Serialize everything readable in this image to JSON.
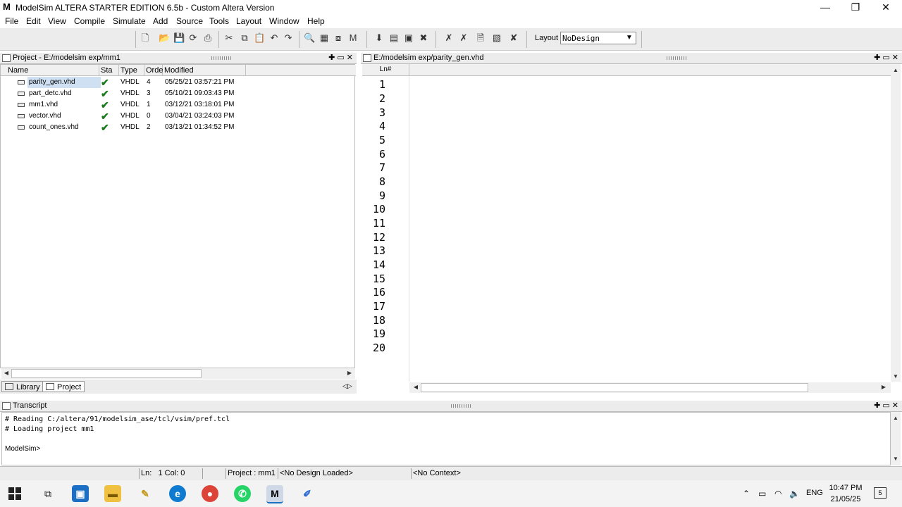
{
  "window": {
    "title": "ModelSim ALTERA STARTER EDITION 6.5b - Custom Altera Version",
    "logo": "M",
    "minimize": "—",
    "restore": "❐",
    "close": "✕"
  },
  "menu": [
    "File",
    "Edit",
    "View",
    "Compile",
    "Simulate",
    "Add",
    "Source",
    "Tools",
    "Layout",
    "Window",
    "Help"
  ],
  "toolbar": {
    "layout_label": "Layout",
    "layout_value": "NoDesign"
  },
  "project_panel": {
    "title": "Project - E:/modelsim exp/mm1",
    "columns": [
      "Name",
      "Sta",
      "Type",
      "Orde",
      "Modified"
    ],
    "files": [
      {
        "name": "parity_gen.vhd",
        "status": "✔",
        "type": "VHDL",
        "order": "4",
        "modified": "05/25/21 03:57:21 PM"
      },
      {
        "name": "part_detc.vhd",
        "status": "✔",
        "type": "VHDL",
        "order": "3",
        "modified": "05/10/21 09:03:43 PM"
      },
      {
        "name": "mm1.vhd",
        "status": "✔",
        "type": "VHDL",
        "order": "1",
        "modified": "03/12/21 03:18:01 PM"
      },
      {
        "name": "vector.vhd",
        "status": "✔",
        "type": "VHDL",
        "order": "0",
        "modified": "03/04/21 03:24:03 PM"
      },
      {
        "name": "count_ones.vhd",
        "status": "✔",
        "type": "VHDL",
        "order": "2",
        "modified": "03/13/21 01:34:52 PM"
      }
    ],
    "tabs": [
      "Library",
      "Project"
    ]
  },
  "editor": {
    "title": "E:/modelsim exp/parity_gen.vhd",
    "line_header": "Ln#",
    "line_numbers": [
      "1",
      "2",
      "3",
      "4",
      "5",
      "6",
      "7",
      "8",
      "9",
      "10",
      "11",
      "12",
      "13",
      "14",
      "15",
      "16",
      "17",
      "18",
      "19",
      "20"
    ]
  },
  "transcript": {
    "title": "Transcript",
    "lines": [
      "# Reading C:/altera/91/modelsim_ase/tcl/vsim/pref.tcl",
      "# Loading project mm1",
      "",
      "ModelSim>"
    ]
  },
  "status": {
    "ln_label": "Ln:",
    "ln_value": "1",
    "col_label": "Col:",
    "col_value": "0",
    "project": "Project : mm1",
    "design": "<No Design Loaded>",
    "context": "<No Context>"
  },
  "taskbar": {
    "lang": "ENG",
    "time": "10:47 PM",
    "date": "21/05/25",
    "notifications": "5"
  }
}
